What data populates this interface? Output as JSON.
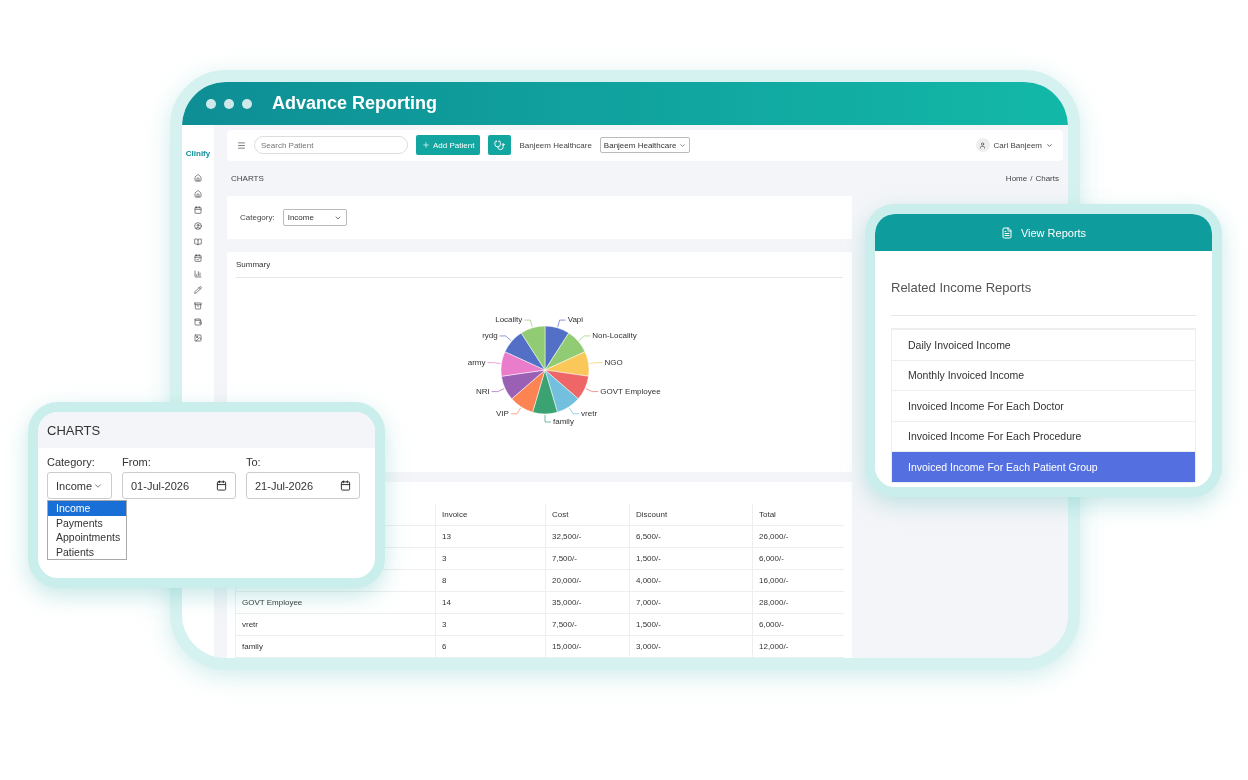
{
  "window": {
    "title": "Advance Reporting"
  },
  "app": {
    "logo": "Clinify",
    "topbar": {
      "search_placeholder": "Search Patient",
      "add_button": "Add Patient",
      "clinic_name": "Banjeem Healthcare",
      "clinic_select": "Banjeem Healthcare",
      "user": "Carl Banjeem"
    },
    "page_title": "CHARTS",
    "breadcrumb": {
      "items": [
        "Home",
        "Charts"
      ],
      "separator": "/"
    },
    "filter": {
      "label": "Category:",
      "value": "Income"
    },
    "summary": {
      "title": "Summary",
      "slices": [
        {
          "label": "Vapi",
          "color": "#5470c6"
        },
        {
          "label": "Non-Locality",
          "color": "#91cc75"
        },
        {
          "label": "NGO",
          "color": "#fac858"
        },
        {
          "label": "GOVT Employee",
          "color": "#ee6666"
        },
        {
          "label": "vretr",
          "color": "#73c0de"
        },
        {
          "label": "family",
          "color": "#3ba272"
        },
        {
          "label": "VIP",
          "color": "#fc8452"
        },
        {
          "label": "NRI",
          "color": "#9a60b4"
        },
        {
          "label": "army",
          "color": "#ea7ccc"
        },
        {
          "label": "rydg",
          "color": "#5470c6"
        },
        {
          "label": "Locality",
          "color": "#91cc75"
        }
      ]
    },
    "table": {
      "columns": [
        "Invoice",
        "Cost",
        "Discount",
        "Total"
      ],
      "rows": [
        {
          "cells": [
            "13",
            "32,500/-",
            "6,500/-",
            "26,000/-"
          ]
        },
        {
          "cells": [
            "3",
            "7,500/-",
            "1,500/-",
            "6,000/-"
          ]
        },
        {
          "cells": [
            "8",
            "20,000/-",
            "4,000/-",
            "16,000/-"
          ]
        },
        {
          "name": "GOVT Employee",
          "cells": [
            "14",
            "35,000/-",
            "7,000/-",
            "28,000/-"
          ]
        },
        {
          "name": "vretr",
          "cells": [
            "3",
            "7,500/-",
            "1,500/-",
            "6,000/-"
          ]
        },
        {
          "name": "family",
          "cells": [
            "6",
            "15,000/-",
            "3,000/-",
            "12,000/-"
          ]
        }
      ]
    }
  },
  "charts_card": {
    "title": "CHARTS",
    "category_label": "Category:",
    "category_value": "Income",
    "options": [
      {
        "label": "Income",
        "selected": true
      },
      {
        "label": "Payments",
        "selected": false
      },
      {
        "label": "Appointments",
        "selected": false
      },
      {
        "label": "Patients",
        "selected": false
      }
    ],
    "from_label": "From:",
    "from_value": "01-Jul-2026",
    "to_label": "To:",
    "to_value": "21-Jul-2026"
  },
  "reports_card": {
    "header": "View Reports",
    "title": "Related Income Reports",
    "items": [
      {
        "label": "Daily Invoiced Income",
        "selected": false
      },
      {
        "label": "Monthly Invoiced Income",
        "selected": false
      },
      {
        "label": "Invoiced Income For Each Doctor",
        "selected": false
      },
      {
        "label": "Invoiced Income For Each Procedure",
        "selected": false
      },
      {
        "label": "Invoiced Income For Each Patient Group",
        "selected": true
      }
    ]
  }
}
